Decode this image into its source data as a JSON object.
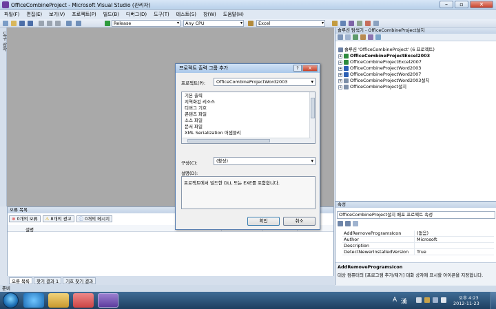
{
  "window": {
    "title": "OfficeCombineProject - Microsoft Visual Studio (관리자)"
  },
  "menu": [
    "파일(F)",
    "편집(E)",
    "보기(V)",
    "프로젝트(P)",
    "빌드(B)",
    "디버그(D)",
    "도구(T)",
    "테스트(S)",
    "창(W)",
    "도움말(H)"
  ],
  "toolbar": {
    "config": "Release",
    "platform": "Any CPU",
    "find": "Excel"
  },
  "left_tab": "도구 상자",
  "solution_explorer": {
    "title": "솔루션 탐색기 - OfficeCombineProject설치",
    "items": [
      {
        "label": "솔루션 'OfficeCombineProject' (6 프로젝트)",
        "bold": false
      },
      {
        "label": "OfficeCombineProjectExcel2003",
        "bold": true
      },
      {
        "label": "OfficeCombineProjectExcel2007",
        "bold": false
      },
      {
        "label": "OfficeCombineProjectWord2003",
        "bold": false
      },
      {
        "label": "OfficeCombineProjectWord2007",
        "bold": false
      },
      {
        "label": "OfficeCombineProjectWord2003설치",
        "bold": false
      },
      {
        "label": "OfficeCombineProject설치",
        "bold": false
      }
    ]
  },
  "properties": {
    "title": "속성",
    "object": "OfficeCombineProject설치 배포 프로젝트 속성",
    "rows": [
      {
        "key": "AddRemoveProgramsIcon",
        "value": "(없음)"
      },
      {
        "key": "Author",
        "value": "Microsoft"
      },
      {
        "key": "Description",
        "value": ""
      },
      {
        "key": "DetectNewerInstalledVersion",
        "value": "True"
      }
    ],
    "desc_title": "AddRemoveProgramsIcon",
    "desc_text": "대상 컴퓨터의 [프로그램 추가/제거] 대화 상자에 표시할 아이콘을 지정합니다."
  },
  "error_list": {
    "title": "오류 목록",
    "errors": "0개의 오류",
    "warnings": "8개의 경고",
    "messages": "0개의 메시지",
    "col_desc": "설명"
  },
  "bottom_tabs": [
    "오류 목록",
    "찾기 결과 1",
    "기호 찾기 결과"
  ],
  "status": "준비",
  "dialog": {
    "title": "프로젝트 출력 그룹 추가",
    "project_label": "프로젝트(P):",
    "project_value": "OfficeCombineProjectWord2003",
    "outputs": [
      "기본 출력",
      "지역화된 리소스",
      "디버그 기호",
      "콘텐츠 파일",
      "소스 파일",
      "문서 파일",
      "XML Serialization 어셈블리"
    ],
    "config_label": "구성(C):",
    "config_value": "(활성)",
    "desc_label": "설명(D):",
    "desc_text": "프로젝트에서 빌드한 DLL 또는 EXE를 포함합니다.",
    "ok": "확인",
    "cancel": "취소",
    "help_glyph": "?",
    "close_glyph": "X"
  },
  "tray": {
    "time": "오후 4:23",
    "date": "2012-11-23",
    "lang": "A",
    "ime": "漢"
  }
}
